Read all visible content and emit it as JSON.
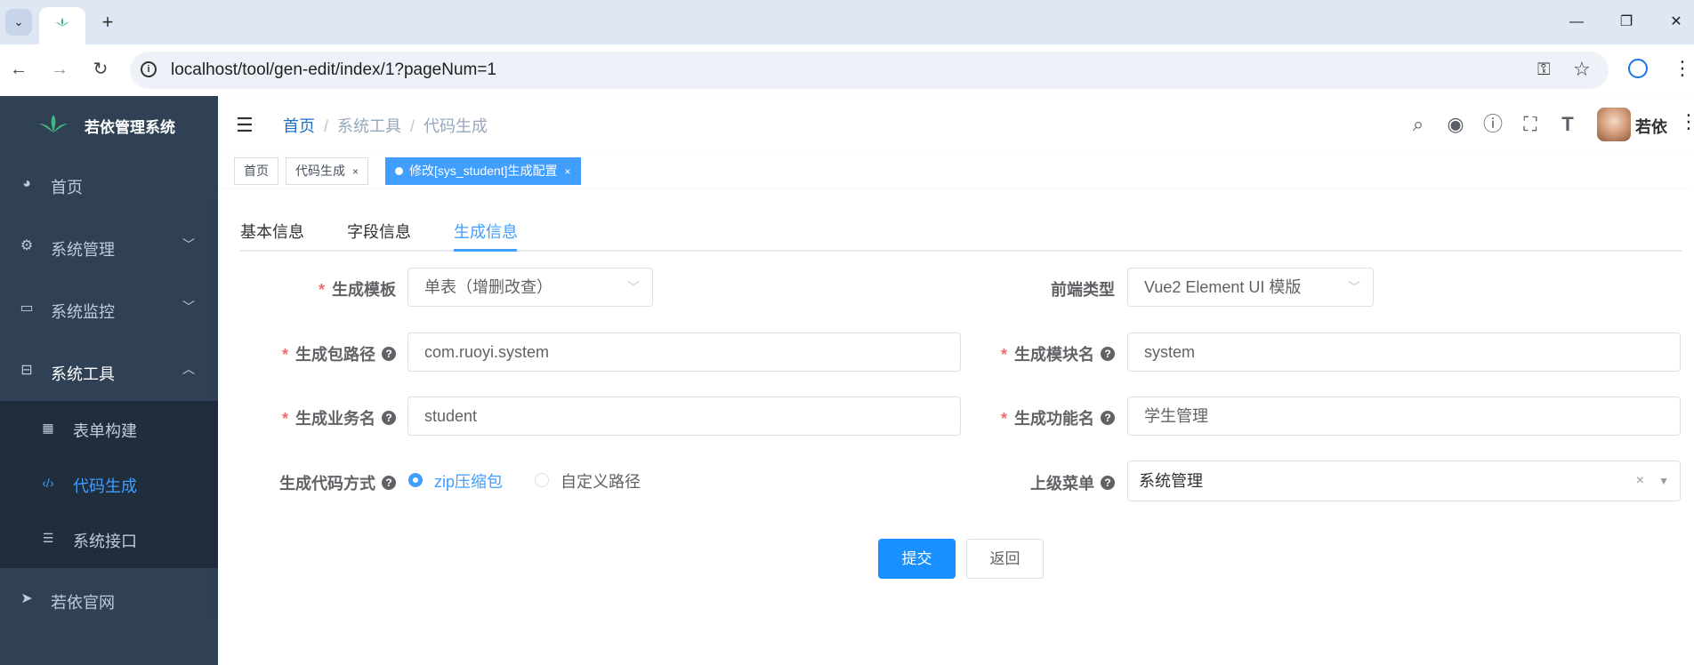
{
  "browser": {
    "url": "localhost/tool/gen-edit/index/1?pageNum=1",
    "new_tab_symbol": "+",
    "window_controls": [
      "—",
      "❐",
      "✕"
    ]
  },
  "sidebar": {
    "title": "若依管理系统",
    "items": [
      {
        "label": "首页",
        "icon": "dashboard-icon"
      },
      {
        "label": "系统管理",
        "icon": "gear-icon"
      },
      {
        "label": "系统监控",
        "icon": "monitor-icon"
      },
      {
        "label": "系统工具",
        "icon": "toolbox-icon"
      }
    ],
    "tool_submenu": [
      {
        "label": "表单构建",
        "icon": "table-icon"
      },
      {
        "label": "代码生成",
        "icon": "code-icon",
        "active": true
      },
      {
        "label": "系统接口",
        "icon": "sliders-icon"
      }
    ],
    "external": {
      "label": "若依官网",
      "icon": "send-icon"
    }
  },
  "navbar": {
    "breadcrumb": [
      "首页",
      "系统工具",
      "代码生成"
    ],
    "user_name": "若依"
  },
  "tags_view": [
    {
      "label": "首页",
      "closable": false,
      "active": false
    },
    {
      "label": "代码生成",
      "closable": true,
      "active": false
    },
    {
      "label": "修改[sys_student]生成配置",
      "closable": true,
      "active": true
    }
  ],
  "tag_close_symbol": "×",
  "tabs": [
    {
      "label": "基本信息"
    },
    {
      "label": "字段信息"
    },
    {
      "label": "生成信息",
      "active": true
    }
  ],
  "form": {
    "template": {
      "label": "生成模板",
      "required": true,
      "value": "单表（增删改查）"
    },
    "frontend_type": {
      "label": "前端类型",
      "value": "Vue2 Element UI 模版"
    },
    "package_path": {
      "label": "生成包路径",
      "required": true,
      "value": "com.ruoyi.system"
    },
    "module_name": {
      "label": "生成模块名",
      "required": true,
      "value": "system"
    },
    "business_name": {
      "label": "生成业务名",
      "required": true,
      "value": "student"
    },
    "function_name": {
      "label": "生成功能名",
      "required": true,
      "value": "学生管理"
    },
    "gen_type": {
      "label": "生成代码方式",
      "options": [
        "zip压缩包",
        "自定义路径"
      ],
      "selected": "zip压缩包"
    },
    "parent_menu": {
      "label": "上级菜单",
      "value": "系统管理"
    },
    "required_mark": "*",
    "help_mark": "?"
  },
  "buttons": {
    "submit": "提交",
    "back": "返回"
  },
  "colors": {
    "primary": "#409eff",
    "sidebar_bg": "#304156",
    "submenu_bg": "#1f2d3d",
    "required": "#f56c6c"
  }
}
